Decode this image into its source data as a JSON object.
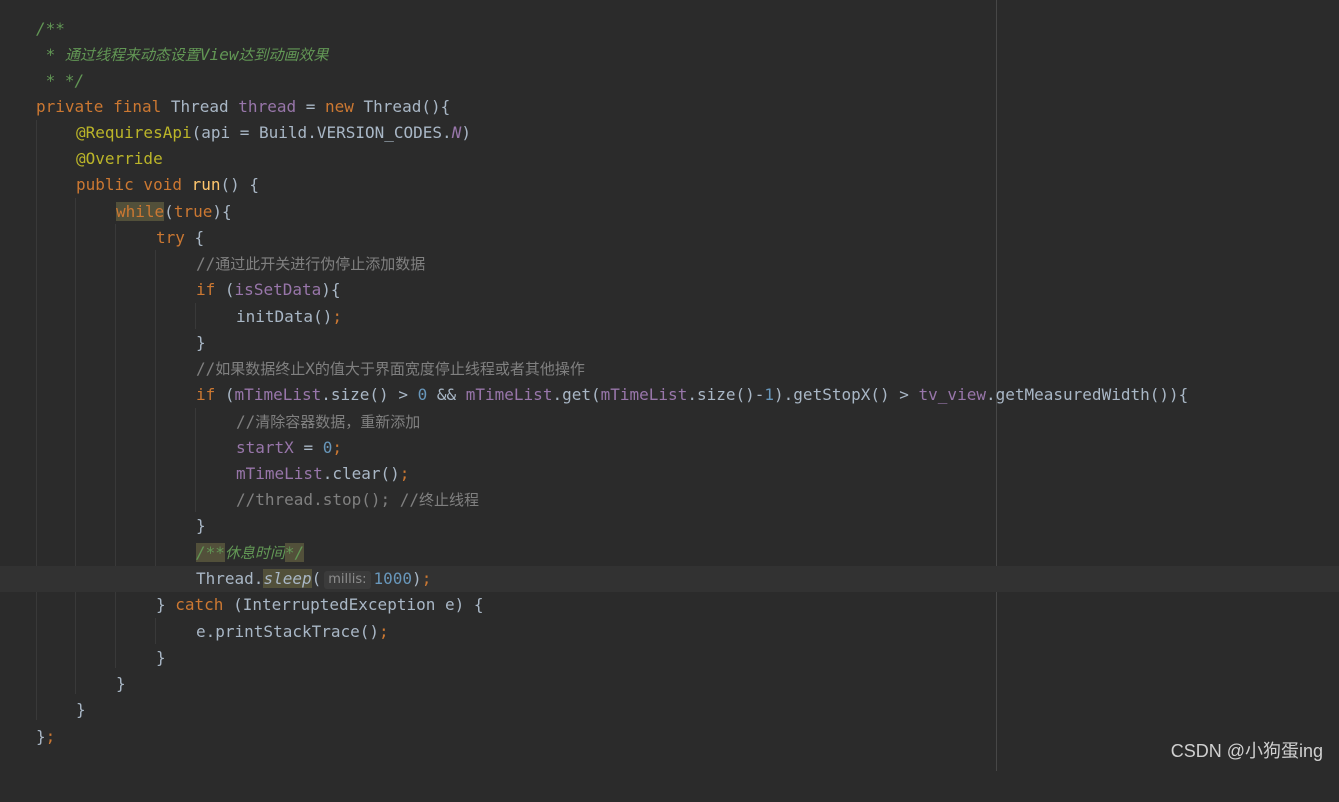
{
  "editor": {
    "theme": "Darcula",
    "colors": {
      "background": "#2b2b2b",
      "current_line": "#323232",
      "keyword": "#cc7832",
      "field": "#9876aa",
      "method": "#ffc66d",
      "annotation": "#bbb529",
      "number": "#6897bb",
      "comment": "#808080",
      "doc_comment": "#629755",
      "text": "#a9b7c6"
    },
    "lines": [
      "/**",
      " * 通过线程来动态设置View达到动画效果",
      " * */",
      "private final Thread thread = new Thread(){",
      "    @RequiresApi(api = Build.VERSION_CODES.N)",
      "    @Override",
      "    public void run() {",
      "        while(true){",
      "            try {",
      "                //通过此开关进行伪停止添加数据",
      "                if (isSetData){",
      "                    initData();",
      "                }",
      "                //如果数据终止X的值大于界面宽度停止线程或者其他操作",
      "                if (mTimeList.size() > 0 && mTimeList.get(mTimeList.size()-1).getStopX() > tv_view.getMeasuredWidth()){",
      "                    //清除容器数据，重新添加",
      "                    startX = 0;",
      "                    mTimeList.clear();",
      "                    //thread.stop(); //终止线程",
      "                }",
      "                /**休息时间*/",
      "                Thread.sleep( millis: 1000);",
      "            } catch (InterruptedException e) {",
      "                e.printStackTrace();",
      "            }",
      "        }",
      "    }",
      "};"
    ],
    "inlay_hint": "millis:"
  },
  "watermark": "CSDN @小狗蛋ing"
}
